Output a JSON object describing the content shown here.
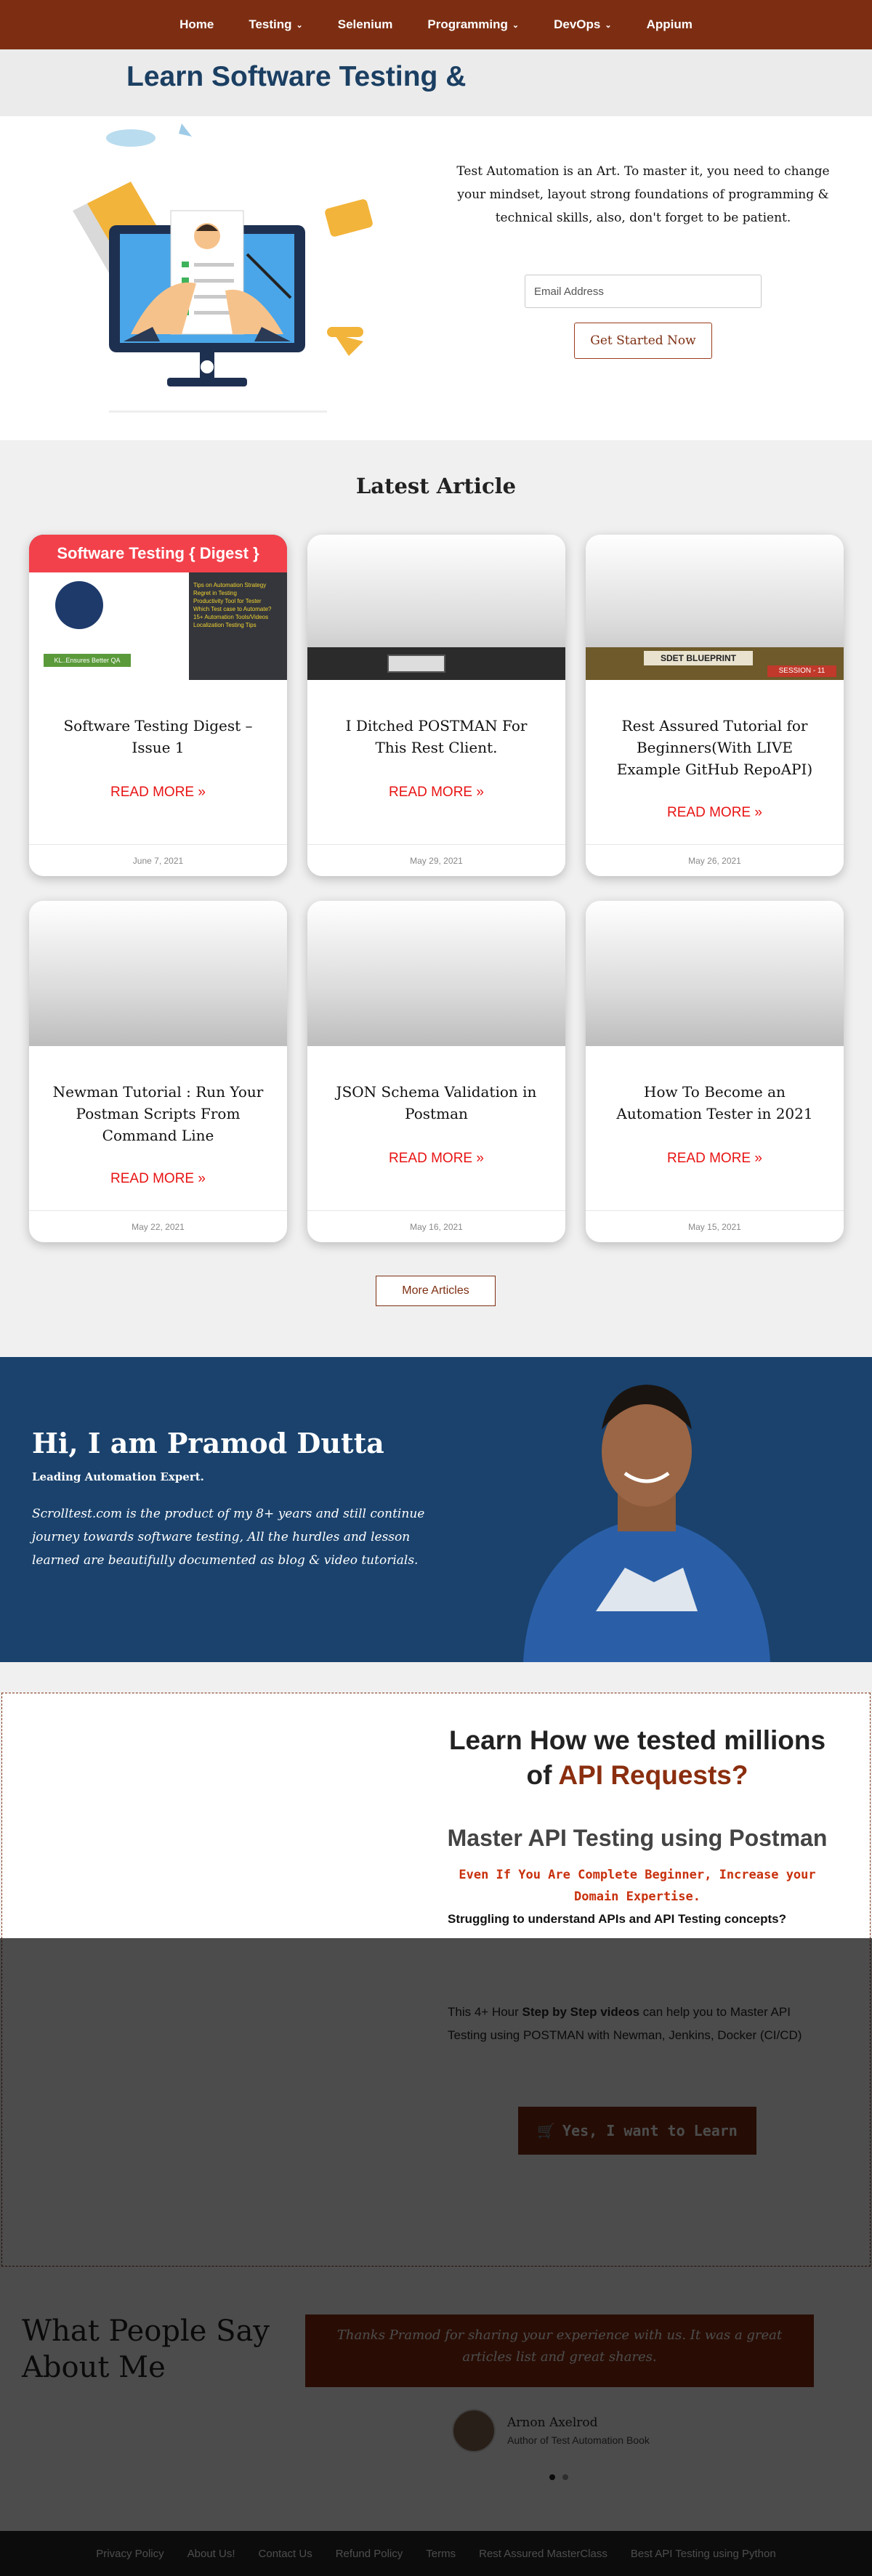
{
  "nav": {
    "items": [
      {
        "label": "Home",
        "dropdown": false
      },
      {
        "label": "Testing",
        "dropdown": true
      },
      {
        "label": "Selenium",
        "dropdown": false
      },
      {
        "label": "Programming",
        "dropdown": true
      },
      {
        "label": "DevOps",
        "dropdown": true
      },
      {
        "label": "Appium",
        "dropdown": false
      }
    ]
  },
  "hero": {
    "title": "Learn Software Testing &",
    "text": "Test Automation is an Art. To master it, you need to change your mindset, layout strong foundations of programming & technical skills, also, don't forget to be patient.",
    "email_placeholder": "Email Address",
    "cta": "Get Started Now"
  },
  "latest": {
    "title": "Latest Article",
    "read_more": "READ MORE »",
    "more_button": "More Articles",
    "articles": [
      {
        "title": "Software Testing Digest – Issue 1",
        "date": "June 7, 2021",
        "banner": "Software Testing { Digest }"
      },
      {
        "title": "I Ditched POSTMAN For This Rest Client.",
        "date": "May 29, 2021"
      },
      {
        "title": "Rest Assured Tutorial for Beginners(With LIVE Example GitHub RepoAPI)",
        "date": "May 26, 2021",
        "badge": "SDET BLUEPRINT",
        "badge2": "SESSION - 11"
      },
      {
        "title": "Newman Tutorial : Run Your Postman Scripts From Command Line",
        "date": "May 22, 2021"
      },
      {
        "title": "JSON Schema Validation in Postman",
        "date": "May 16, 2021"
      },
      {
        "title": "How To Become an Automation Tester in 2021",
        "date": "May 15, 2021"
      }
    ],
    "digest_items": [
      "Tips on Automation Strategy",
      "Regret in Testing",
      "Productivity Tool for Tester",
      "Which Test case to Automate?",
      "15+ Automation Tools/Videos",
      "Localization Testing Tips"
    ],
    "digest_tag": "KL..Ensures Better QA"
  },
  "about": {
    "title": "Hi, I am Pramod Dutta",
    "subtitle": "Leading Automation Expert.",
    "description": "Scrolltest.com is the product of my 8+ years and still continue journey towards software testing, All the hurdles and lesson learned are beautifully documented as blog & video tutorials."
  },
  "course": {
    "heading_line1": "Learn How we tested millions",
    "heading_of": "of ",
    "heading_accent": "API Requests?",
    "subheading": "Master API Testing using Postman",
    "tagline": "Even If You Are Complete Beginner, Increase your Domain Expertise.",
    "question": "Struggling to understand APIs and API Testing concepts?",
    "para_before": "This 4+ Hour ",
    "para_bold": "Step by Step videos",
    "para_after": " can help you to Master API Testing using POSTMAN with Newman, Jenkins, Docker (CI/CD)",
    "cta": "Yes, I want to Learn"
  },
  "testimonials": {
    "heading": "What People Say About Me",
    "quote": "Thanks Pramod for sharing your experience with us. It was a great articles list and great shares.",
    "author_name": "Arnon Axelrod",
    "author_role": "Author of Test Automation Book"
  },
  "footer": {
    "links": [
      "Privacy Policy",
      "About Us!",
      "Contact Us",
      "Refund Policy",
      "Terms",
      "Rest Assured MasterClass",
      "Best API Testing using Python"
    ]
  },
  "colors": {
    "brand": "#7d2e12",
    "navy": "#1a426d",
    "read_more": "#e81313"
  }
}
